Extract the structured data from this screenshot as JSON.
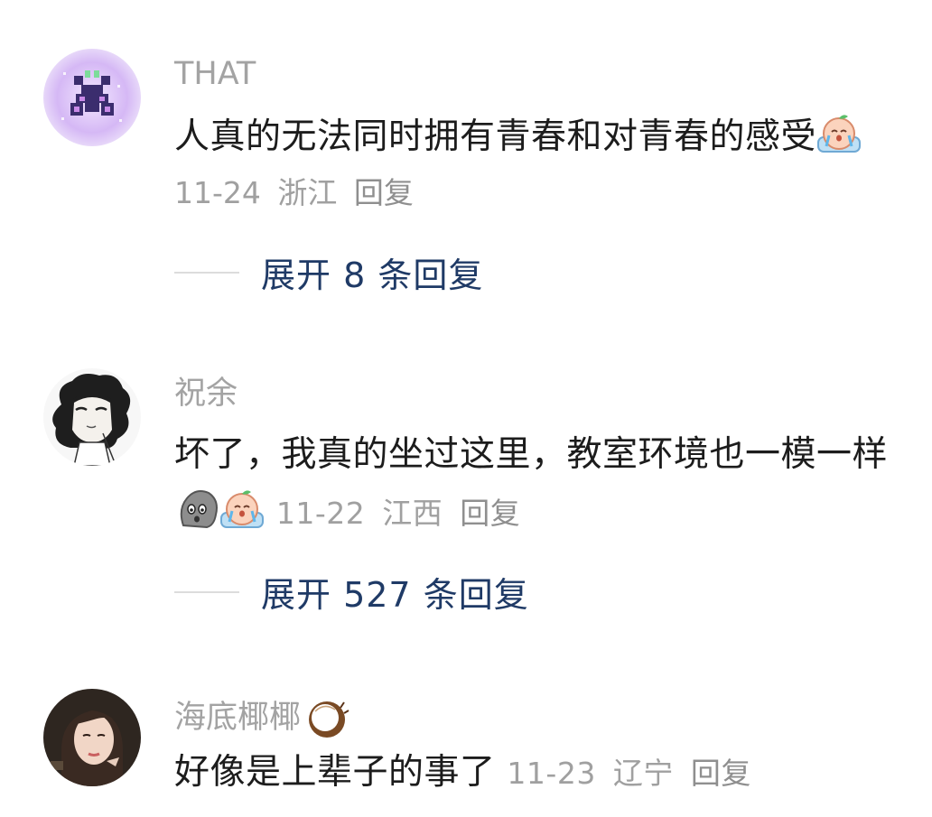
{
  "comments": [
    {
      "username": "THAT",
      "text": "人真的无法同时拥有青春和对青春的感受",
      "trailing_emoji": "crying-peach-emoji",
      "date": "11-24",
      "location": "浙江",
      "reply_label": "回复",
      "expand_label": "展开 8 条回复"
    },
    {
      "username": "祝余",
      "text": "坏了，我真的坐过这里，教室环境也一模一样",
      "trailing_emoji": [
        "shocked-rock-emoji",
        "crying-peach-emoji"
      ],
      "date": "11-22",
      "location": "江西",
      "reply_label": "回复",
      "expand_label": "展开 527 条回复"
    },
    {
      "username": "海底椰椰",
      "username_emoji": "coconut-emoji",
      "text": "好像是上辈子的事了",
      "date": "11-23",
      "location": "辽宁",
      "reply_label": "回复"
    }
  ],
  "colors": {
    "username": "#a3a3a3",
    "body": "#1c1c1c",
    "meta": "#a0a0a0",
    "expand_link": "#1f3a66"
  }
}
